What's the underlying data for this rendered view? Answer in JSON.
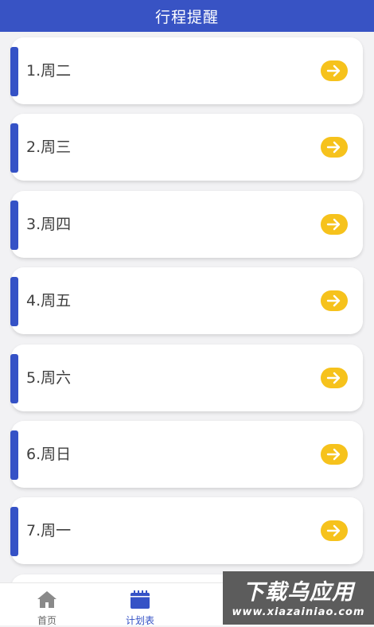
{
  "header": {
    "title": "行程提醒"
  },
  "colors": {
    "header_bg": "#3853c4",
    "accent": "#3552c6",
    "arrow_button": "#f6c21c"
  },
  "list": {
    "items": [
      {
        "label": "1.周二",
        "icon": "arrow-right-icon"
      },
      {
        "label": "2.周三",
        "icon": "arrow-right-icon"
      },
      {
        "label": "3.周四",
        "icon": "arrow-right-icon"
      },
      {
        "label": "4.周五",
        "icon": "arrow-right-icon"
      },
      {
        "label": "5.周六",
        "icon": "arrow-right-icon"
      },
      {
        "label": "6.周日",
        "icon": "arrow-right-icon"
      },
      {
        "label": "7.周一",
        "icon": "arrow-right-icon"
      },
      {
        "label": ""
      }
    ]
  },
  "tabbar": {
    "tabs": [
      {
        "label": "首页",
        "icon": "home-icon"
      },
      {
        "label": "计划表",
        "icon": "calendar-icon",
        "active": true
      },
      {
        "label": "",
        "icon": ""
      },
      {
        "label": "",
        "icon": ""
      }
    ]
  },
  "watermark": {
    "title": "下载乌应用",
    "url": "www.xiazainiao.com"
  }
}
